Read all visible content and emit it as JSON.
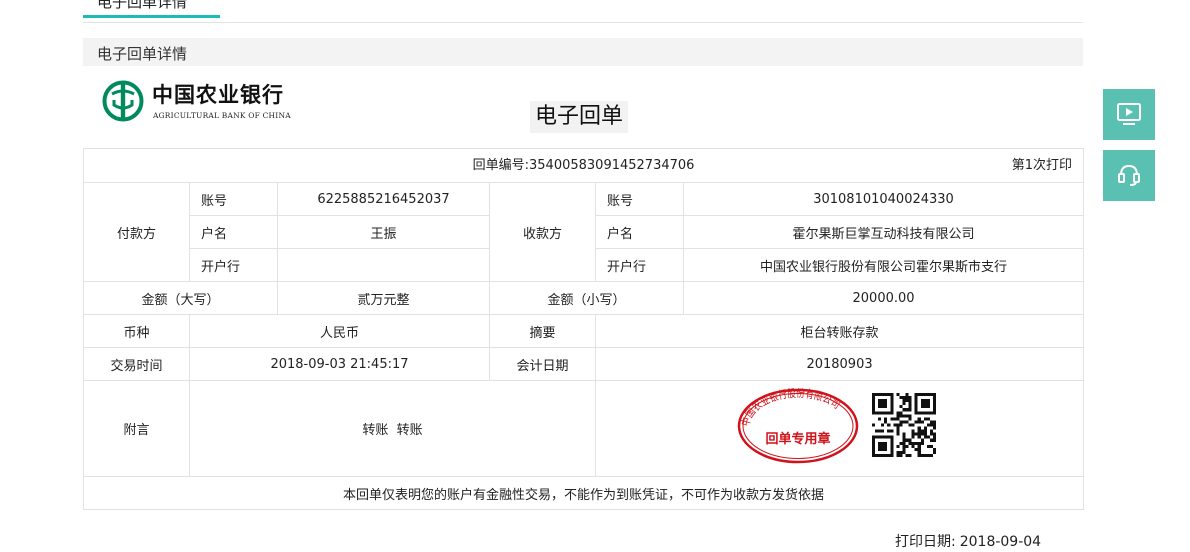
{
  "tab": {
    "label": "电子回单详情"
  },
  "section": {
    "title": "电子回单详情"
  },
  "bank": {
    "name_cn": "中国农业银行",
    "name_en": "AGRICULTURAL BANK OF CHINA"
  },
  "document_title": "电子回单",
  "receipt": {
    "number_label": "回单编号:",
    "number": "35400583091452734706",
    "print_count": "第1次打印",
    "payer": {
      "section_label": "付款方",
      "account_label": "账号",
      "account": "6225885216452037",
      "name_label": "户名",
      "name": "王振",
      "bank_label": "开户行",
      "bank": ""
    },
    "payee": {
      "section_label": "收款方",
      "account_label": "账号",
      "account": "30108101040024330",
      "name_label": "户名",
      "name": "霍尔果斯巨掌互动科技有限公司",
      "bank_label": "开户行",
      "bank": "中国农业银行股份有限公司霍尔果斯市支行"
    },
    "amount_upper_label": "金额（大写）",
    "amount_upper": "贰万元整",
    "amount_lower_label": "金额（小写）",
    "amount_lower": "20000.00",
    "currency_label": "币种",
    "currency": "人民币",
    "summary_label": "摘要",
    "summary": "柜台转账存款",
    "time_label": "交易时间",
    "time": "2018-09-03 21:45:17",
    "acct_date_label": "会计日期",
    "acct_date": "20180903",
    "note_label": "附言",
    "note": "转账  转账",
    "stamp_top_text": "中国农业银行股份有限公司",
    "stamp_bottom_text": "回单专用章",
    "disclaimer": "本回单仅表明您的账户有金融性交易，不能作为到账凭证，不可作为收款方发货依据"
  },
  "print_date_label": "打印日期:",
  "print_date": "2018-09-04",
  "side_buttons": [
    {
      "icon": "play-screen-icon"
    },
    {
      "icon": "customer-service-icon"
    }
  ],
  "colors": {
    "accent": "#1cbbb4",
    "side_button": "#5ac0b2",
    "stamp_red": "#d0121b",
    "bank_green": "#008a5e"
  }
}
